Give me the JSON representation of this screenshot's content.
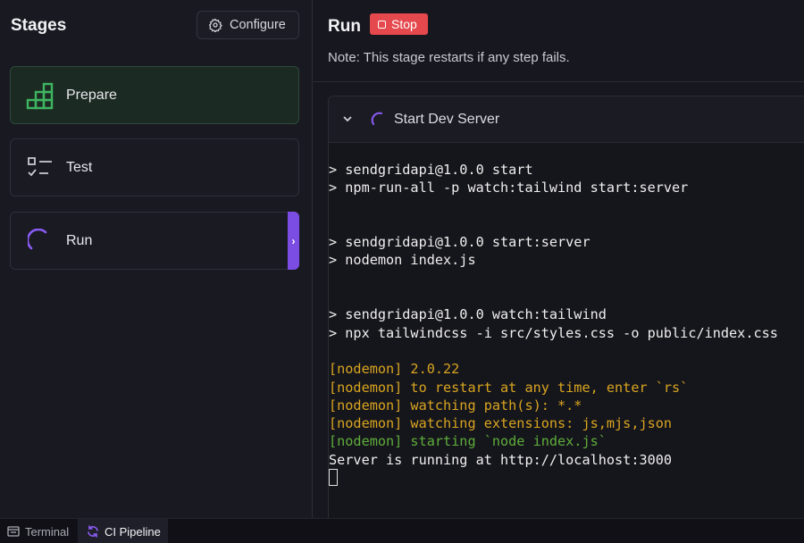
{
  "stages_panel": {
    "title": "Stages",
    "configure_label": "Configure",
    "items": [
      {
        "label": "Prepare",
        "icon": "stairs-icon",
        "status": "done"
      },
      {
        "label": "Test",
        "icon": "checklist-icon",
        "status": "idle"
      },
      {
        "label": "Run",
        "icon": "spinner-icon",
        "status": "running"
      }
    ]
  },
  "run_panel": {
    "title": "Run",
    "stop_label": "Stop",
    "note": "Note: This stage restarts if any step fails.",
    "step": {
      "title": "Start Dev Server",
      "expanded": true
    },
    "terminal_lines": [
      {
        "text": "> sendgridapi@1.0.0 start",
        "color": "default"
      },
      {
        "text": "> npm-run-all -p watch:tailwind start:server",
        "color": "default"
      },
      {
        "text": "",
        "color": "default"
      },
      {
        "text": "",
        "color": "default"
      },
      {
        "text": "> sendgridapi@1.0.0 start:server",
        "color": "default"
      },
      {
        "text": "> nodemon index.js",
        "color": "default"
      },
      {
        "text": "",
        "color": "default"
      },
      {
        "text": "",
        "color": "default"
      },
      {
        "text": "> sendgridapi@1.0.0 watch:tailwind",
        "color": "default"
      },
      {
        "text": "> npx tailwindcss -i src/styles.css -o public/index.css",
        "color": "default"
      },
      {
        "text": "",
        "color": "default"
      },
      {
        "text": "[nodemon] 2.0.22",
        "color": "yellow"
      },
      {
        "text": "[nodemon] to restart at any time, enter `rs`",
        "color": "yellow"
      },
      {
        "text": "[nodemon] watching path(s): *.*",
        "color": "yellow"
      },
      {
        "text": "[nodemon] watching extensions: js,mjs,json",
        "color": "yellow"
      },
      {
        "text": "[nodemon] starting `node index.js`",
        "color": "green"
      },
      {
        "text": "Server is running at http://localhost:3000",
        "color": "default"
      }
    ]
  },
  "bottom_bar": {
    "tabs": [
      {
        "label": "Terminal",
        "icon": "terminal-icon",
        "active": false
      },
      {
        "label": "CI Pipeline",
        "icon": "refresh-icon",
        "active": true
      }
    ]
  },
  "colors": {
    "accent": "#7c4de3",
    "stop": "#e5484d",
    "success": "#3fb560",
    "log_yellow": "#d9a520",
    "log_green": "#5fae3a"
  }
}
